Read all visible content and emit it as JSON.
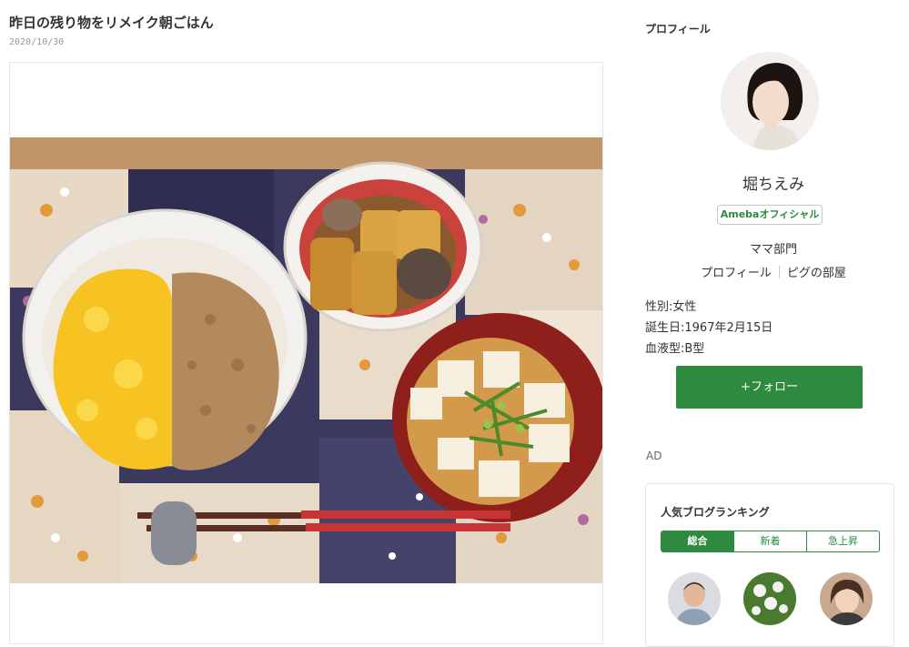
{
  "post": {
    "title": "昨日の残り物をリメイク朝ごはん",
    "date": "2020/10/30"
  },
  "profile": {
    "section_title": "プロフィール",
    "name": "堀ちえみ",
    "badge": "Amebaオフィシャル",
    "category": "ママ部門",
    "links": [
      "プロフィール",
      "ピグの部屋"
    ],
    "info": [
      "性別:女性",
      "誕生日:1967年2月15日",
      "血液型:B型"
    ],
    "follow_label": "+フォロー"
  },
  "ad_label": "AD",
  "ranking": {
    "title": "人気ブログランキング",
    "tabs": [
      "総合",
      "新着",
      "急上昇"
    ]
  },
  "colors": {
    "accent": "#2d8a3e"
  }
}
